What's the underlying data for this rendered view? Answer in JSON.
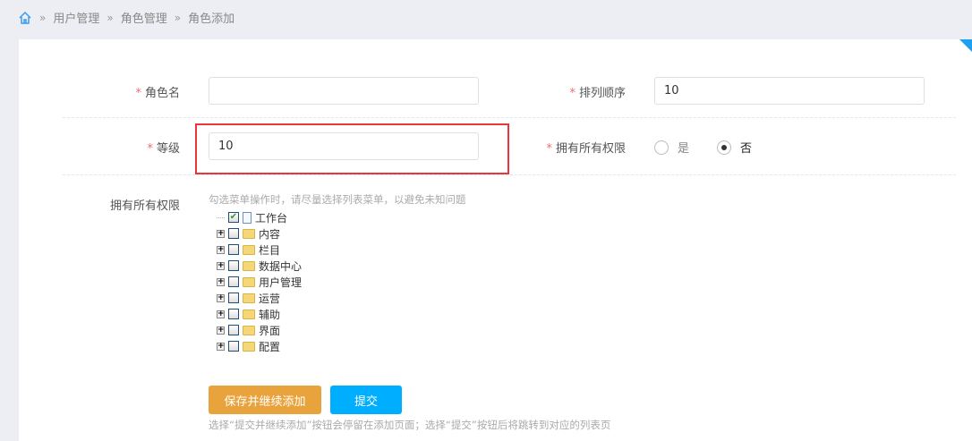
{
  "breadcrumb": {
    "items": [
      "用户管理",
      "角色管理",
      "角色添加"
    ],
    "sep": "»"
  },
  "form": {
    "role_name": {
      "label": "角色名",
      "value": ""
    },
    "sort_order": {
      "label": "排列顺序",
      "value": "10"
    },
    "level": {
      "label": "等级",
      "value": "10"
    },
    "all_perm": {
      "label": "拥有所有权限",
      "options": [
        "是",
        "否"
      ],
      "selected": "否"
    },
    "perms": {
      "label": "拥有所有权限",
      "hint": "勾选菜单操作时，请尽量选择列表菜单，以避免未知问题"
    },
    "required_mark": "*"
  },
  "tree": [
    {
      "label": "工作台",
      "checked": true,
      "type": "file"
    },
    {
      "label": "内容",
      "checked": false,
      "type": "folder"
    },
    {
      "label": "栏目",
      "checked": false,
      "type": "folder"
    },
    {
      "label": "数据中心",
      "checked": false,
      "type": "folder"
    },
    {
      "label": "用户管理",
      "checked": false,
      "type": "folder"
    },
    {
      "label": "运营",
      "checked": false,
      "type": "folder"
    },
    {
      "label": "辅助",
      "checked": false,
      "type": "folder"
    },
    {
      "label": "界面",
      "checked": false,
      "type": "folder"
    },
    {
      "label": "配置",
      "checked": false,
      "type": "folder"
    }
  ],
  "buttons": {
    "save_continue": "保存并继续添加",
    "submit": "提交",
    "note": "选择“提交并继续添加”按钮会停留在添加页面；选择“提交”按钮后将跳转到对应的列表页"
  },
  "colors": {
    "accent": "#00aeff",
    "orange": "#e8a33d",
    "highlight": "#e8363b"
  }
}
